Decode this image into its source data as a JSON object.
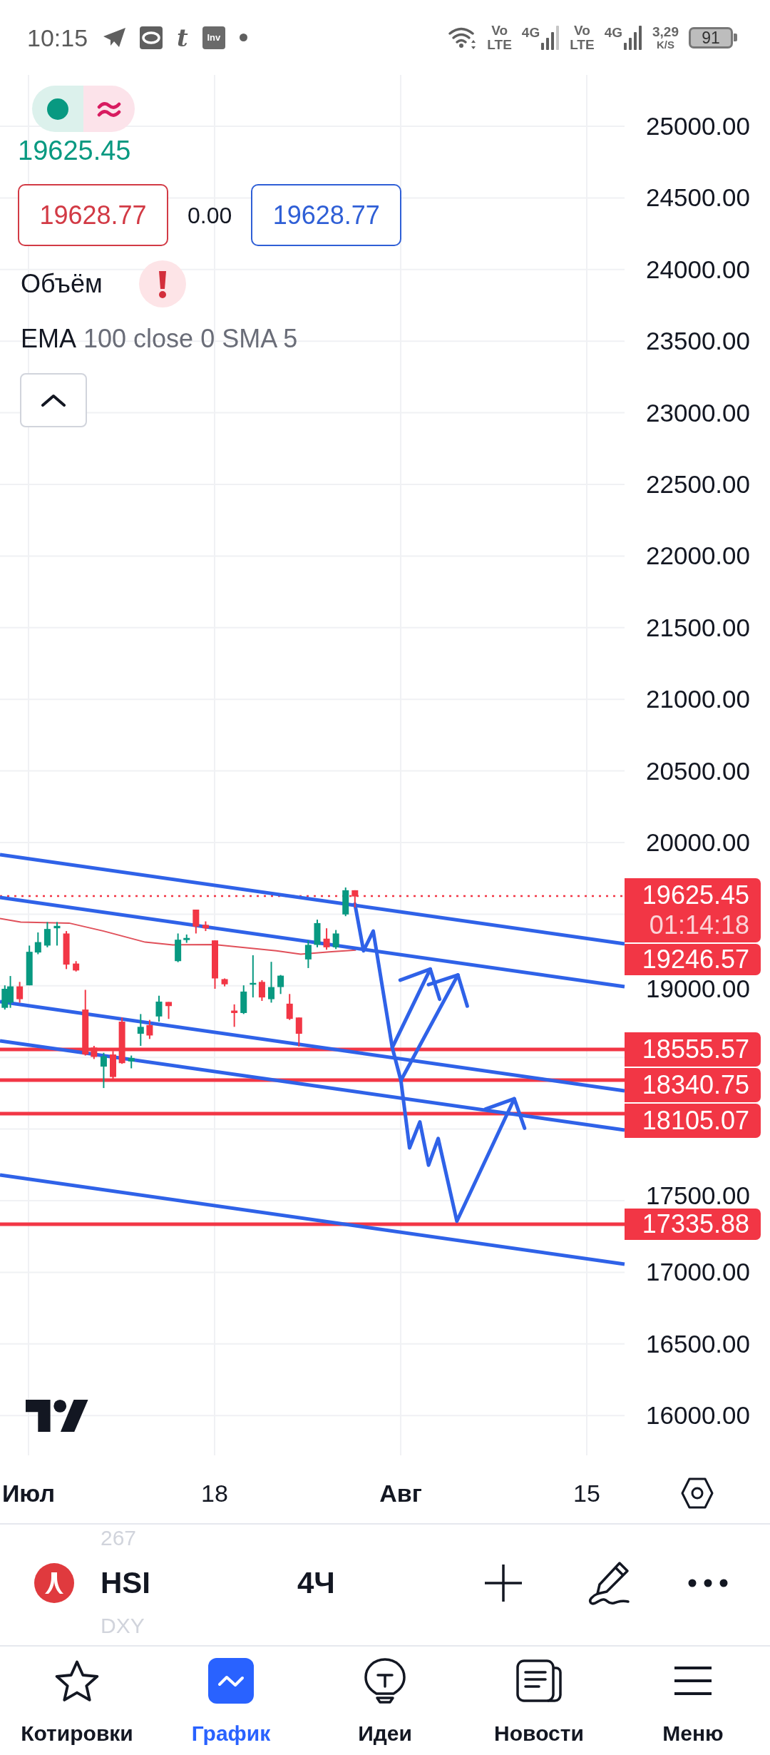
{
  "status_bar": {
    "time": "10:15",
    "app_letter": "t",
    "app_tile": "Inv",
    "networks": [
      {
        "top": "Vo",
        "bottom": "LTE",
        "type": "4G"
      },
      {
        "top": "Vo",
        "bottom": "LTE",
        "type": "4G"
      }
    ],
    "speed": "3,29",
    "speed_unit": "K/S",
    "battery": "91"
  },
  "legend": {
    "last_price": "19625.45",
    "sell_price": "19628.77",
    "spread": "0.00",
    "buy_price": "19628.77",
    "volume_label": "Объём",
    "indicator": {
      "name": "EMA",
      "params": "100 close 0 SMA 5"
    }
  },
  "price_axis": [
    "25000.00",
    "24500.00",
    "24000.00",
    "23500.00",
    "23000.00",
    "22500.00",
    "22000.00",
    "21500.00",
    "21000.00",
    "20500.00",
    "20000.00",
    "19000.00",
    "17500.00",
    "17000.00",
    "16500.00",
    "16000.00"
  ],
  "price_tags": [
    {
      "price": "19625.45",
      "countdown": "01:14:18"
    },
    {
      "price": "19246.57"
    },
    {
      "price": "18555.57"
    },
    {
      "price": "18340.75"
    },
    {
      "price": "18105.07"
    },
    {
      "price": "17335.88"
    }
  ],
  "time_axis": [
    {
      "label": "Июл",
      "kind": "month"
    },
    {
      "label": "18",
      "kind": "day"
    },
    {
      "label": "Авг",
      "kind": "month"
    },
    {
      "label": "15",
      "kind": "day"
    }
  ],
  "symbol_bar": {
    "ghost_above": "267",
    "symbol": "HSI",
    "interval": "4Ч",
    "ghost_below": "DXY"
  },
  "nav": [
    {
      "label": "Котировки",
      "selected": false
    },
    {
      "label": "График",
      "selected": true
    },
    {
      "label": "Идеи",
      "selected": false
    },
    {
      "label": "Новости",
      "selected": false
    },
    {
      "label": "Меню",
      "selected": false
    }
  ]
}
